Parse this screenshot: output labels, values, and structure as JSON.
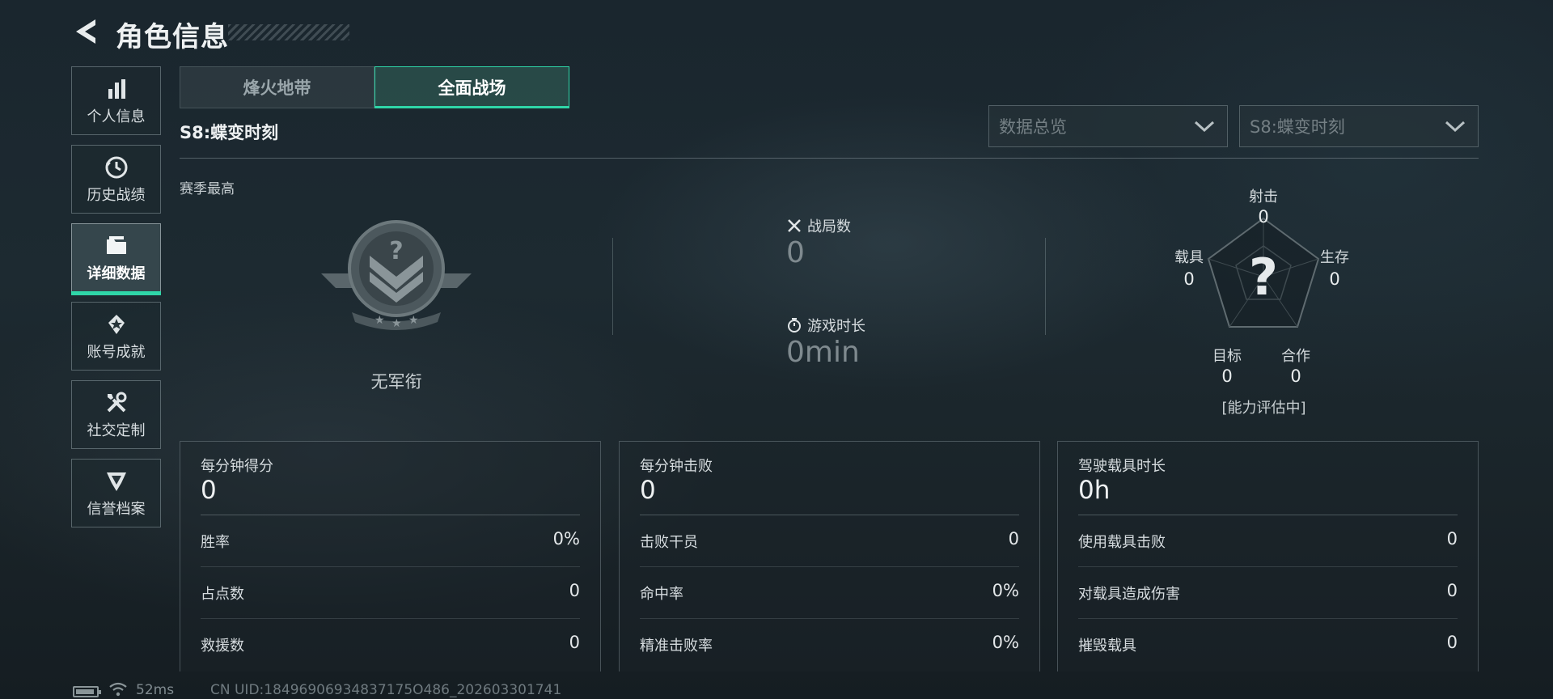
{
  "header": {
    "title": "角色信息"
  },
  "sidebar": {
    "items": [
      {
        "label": "个人信息",
        "icon": "bar-chart-icon"
      },
      {
        "label": "历史战绩",
        "icon": "history-clock-icon"
      },
      {
        "label": "详细数据",
        "icon": "folder-icon",
        "active": true
      },
      {
        "label": "账号成就",
        "icon": "medal-icon"
      },
      {
        "label": "社交定制",
        "icon": "tools-icon"
      },
      {
        "label": "信誉档案",
        "icon": "shield-emblem-icon"
      }
    ]
  },
  "tabs": [
    {
      "label": "烽火地带",
      "active": false
    },
    {
      "label": "全面战场",
      "active": true
    }
  ],
  "season": {
    "title": "S8:蝶变时刻",
    "best_label": "赛季最高"
  },
  "filters": {
    "data_view": "数据总览",
    "season": "S8:蝶变时刻"
  },
  "rank": {
    "name": "无军衔",
    "badge_mark": "?"
  },
  "summary": {
    "matches_label": "战局数",
    "matches_value": "0",
    "playtime_label": "游戏时长",
    "playtime_value": "0min"
  },
  "radar": {
    "center_mark": "?",
    "shooting_label": "射击",
    "shooting_value": "0",
    "survival_label": "生存",
    "survival_value": "0",
    "cooperation_label": "合作",
    "cooperation_value": "0",
    "objective_label": "目标",
    "objective_value": "0",
    "vehicle_label": "载具",
    "vehicle_value": "0",
    "status": "[能力评估中]"
  },
  "panels": [
    {
      "head_label": "每分钟得分",
      "head_value": "0",
      "rows": [
        {
          "label": "胜率",
          "value": "0%"
        },
        {
          "label": "占点数",
          "value": "0"
        },
        {
          "label": "救援数",
          "value": "0"
        }
      ]
    },
    {
      "head_label": "每分钟击败",
      "head_value": "0",
      "rows": [
        {
          "label": "击败干员",
          "value": "0"
        },
        {
          "label": "命中率",
          "value": "0%"
        },
        {
          "label": "精准击败率",
          "value": "0%"
        }
      ]
    },
    {
      "head_label": "驾驶载具时长",
      "head_value": "0h",
      "rows": [
        {
          "label": "使用载具击败",
          "value": "0"
        },
        {
          "label": "对载具造成伤害",
          "value": "0"
        },
        {
          "label": "摧毁载具",
          "value": "0"
        }
      ]
    }
  ],
  "footer": {
    "ping": "52ms",
    "uid": "CN UID:18496906934837175O486_202603301741"
  },
  "colors": {
    "accent": "#2fd6a8",
    "background": "#1b2830"
  }
}
